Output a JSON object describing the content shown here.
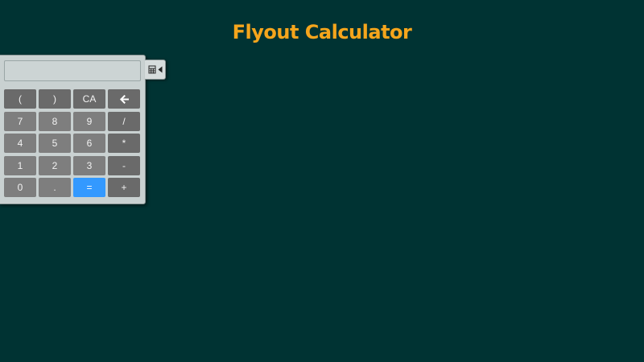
{
  "page": {
    "title": "Flyout Calculator"
  },
  "calculator": {
    "display_value": "",
    "keys": [
      {
        "label": "(",
        "kind": "top",
        "name": "key-open-paren"
      },
      {
        "label": ")",
        "kind": "top",
        "name": "key-close-paren"
      },
      {
        "label": "CA",
        "kind": "top",
        "name": "key-clear-all"
      },
      {
        "label": "",
        "kind": "top",
        "name": "key-backspace",
        "icon": "arrow-left-icon"
      },
      {
        "label": "7",
        "kind": "num",
        "name": "key-7"
      },
      {
        "label": "8",
        "kind": "num",
        "name": "key-8"
      },
      {
        "label": "9",
        "kind": "num",
        "name": "key-9"
      },
      {
        "label": "/",
        "kind": "op",
        "name": "key-divide"
      },
      {
        "label": "4",
        "kind": "num",
        "name": "key-4"
      },
      {
        "label": "5",
        "kind": "num",
        "name": "key-5"
      },
      {
        "label": "6",
        "kind": "num",
        "name": "key-6"
      },
      {
        "label": "*",
        "kind": "op",
        "name": "key-multiply"
      },
      {
        "label": "1",
        "kind": "num",
        "name": "key-1"
      },
      {
        "label": "2",
        "kind": "num",
        "name": "key-2"
      },
      {
        "label": "3",
        "kind": "num",
        "name": "key-3"
      },
      {
        "label": "-",
        "kind": "op",
        "name": "key-subtract"
      },
      {
        "label": "0",
        "kind": "num",
        "name": "key-0"
      },
      {
        "label": ".",
        "kind": "num",
        "name": "key-decimal"
      },
      {
        "label": "=",
        "kind": "equals",
        "name": "key-equals"
      },
      {
        "label": "+",
        "kind": "op",
        "name": "key-add"
      }
    ]
  },
  "toggle": {
    "icons": [
      "calculator-icon",
      "caret-left-icon"
    ]
  },
  "colors": {
    "background": "#003333",
    "title": "#f5a51c",
    "equals_key": "#3399ff"
  }
}
